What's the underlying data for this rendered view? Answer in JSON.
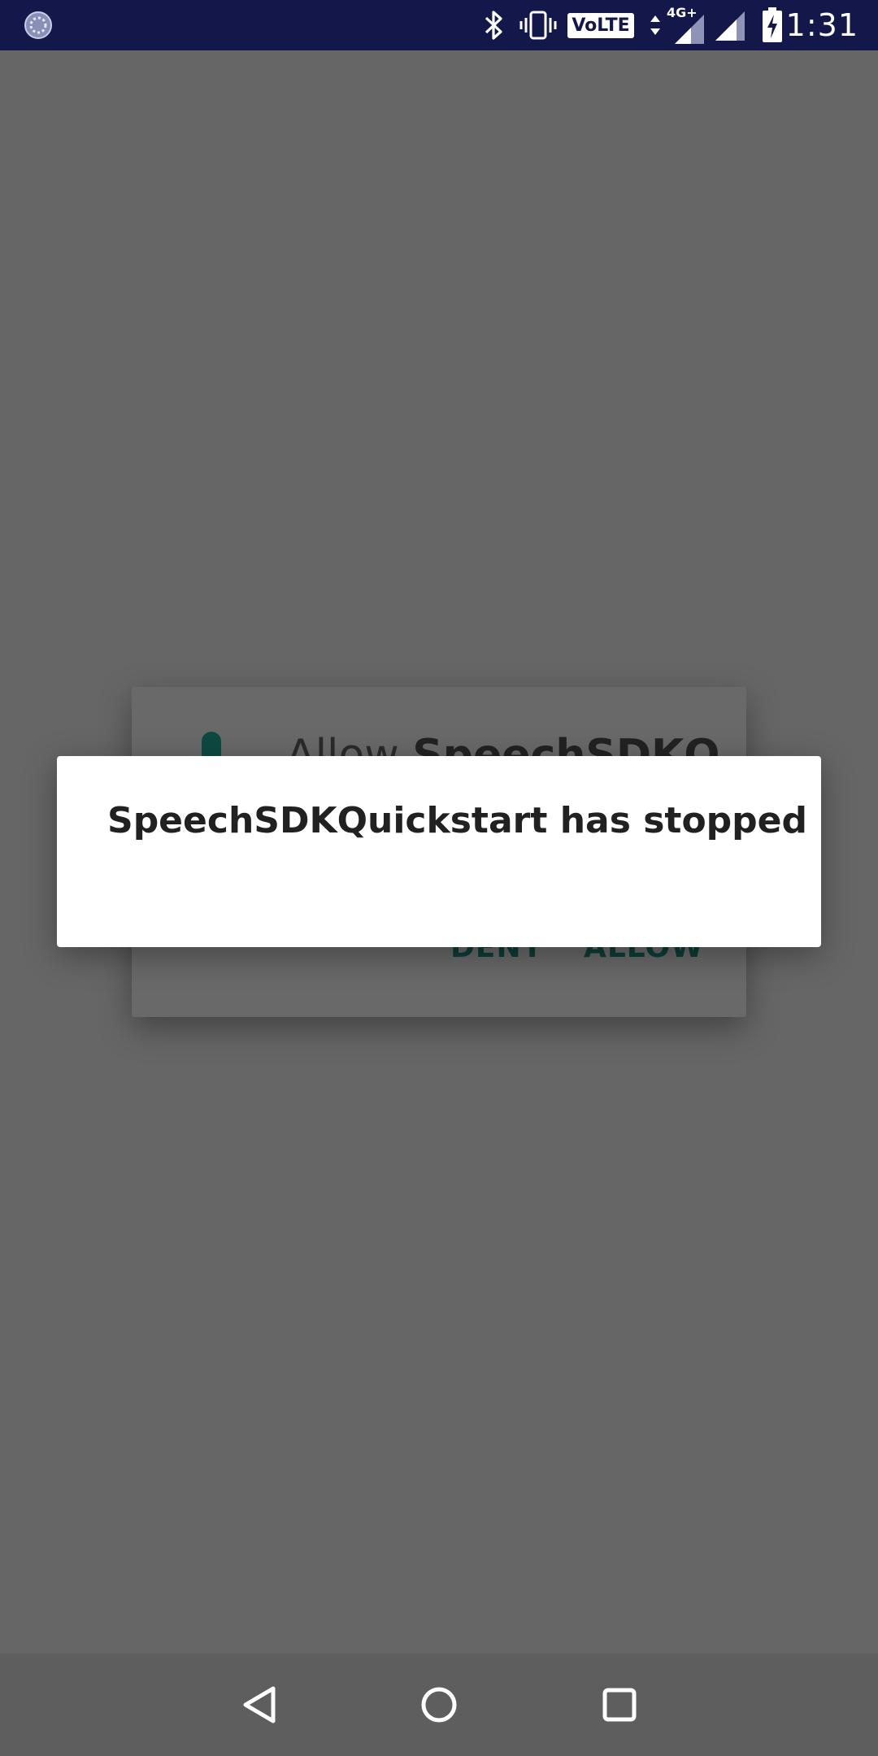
{
  "status_bar": {
    "time": "1:31",
    "network_label": "4G+",
    "volte_label": "VoLTE",
    "icons": [
      "sync-icon",
      "bluetooth-icon",
      "vibrate-icon",
      "volte-icon",
      "data-arrows-icon",
      "signal-icon",
      "signal-icon",
      "battery-charging-icon"
    ]
  },
  "permission_dialog": {
    "title_prefix": "Allow ",
    "title_app": "SpeechSDKQ",
    "deny_label": "DENY",
    "allow_label": "ALLOW",
    "icon": "mic-icon",
    "accent_color": "#0d3d38"
  },
  "crash_dialog": {
    "title": "SpeechSDKQuickstart has stopped"
  },
  "nav_bar": {
    "buttons": [
      "back-icon",
      "home-icon",
      "recents-icon"
    ]
  },
  "colors": {
    "status_bar": "#13174a",
    "scrim": "#666666",
    "nav_bar": "#5e5e5e",
    "dialog": "#ffffff"
  }
}
